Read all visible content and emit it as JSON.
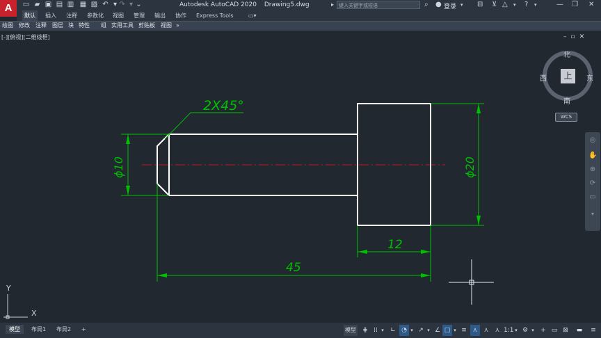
{
  "app": {
    "logo_letter": "A",
    "title": "Autodesk AutoCAD 2020",
    "file": "Drawing5.dwg"
  },
  "search": {
    "placeholder": "键入关键字或短语"
  },
  "account": {
    "login": "登录"
  },
  "ribbon_tabs": [
    "默认",
    "插入",
    "注释",
    "参数化",
    "视图",
    "管理",
    "输出",
    "协作",
    "Express Tools"
  ],
  "panels": [
    "绘图",
    "修改",
    "注释",
    "图层",
    "块",
    "特性",
    "组",
    "实用工具",
    "剪贴板",
    "视图"
  ],
  "viewport": {
    "label": "[-][俯视][二维线框]"
  },
  "viewcube": {
    "top": "上",
    "north": "北",
    "south": "南",
    "east": "东",
    "west": "西",
    "wcs": "WCS"
  },
  "drawing": {
    "chamfer_label": "2X45°",
    "left_diameter": "ϕ10",
    "right_diameter": "ϕ20",
    "dim_12": "12",
    "dim_45": "45",
    "colors": {
      "geometry": "#ffffff",
      "dimension": "#00c000",
      "centerline": "#c8141e"
    }
  },
  "ucs": {
    "x": "X",
    "y": "Y"
  },
  "layout_tabs": [
    "模型",
    "布局1",
    "布局2",
    "+"
  ],
  "status": {
    "model": "模型",
    "scale": "1:1"
  }
}
